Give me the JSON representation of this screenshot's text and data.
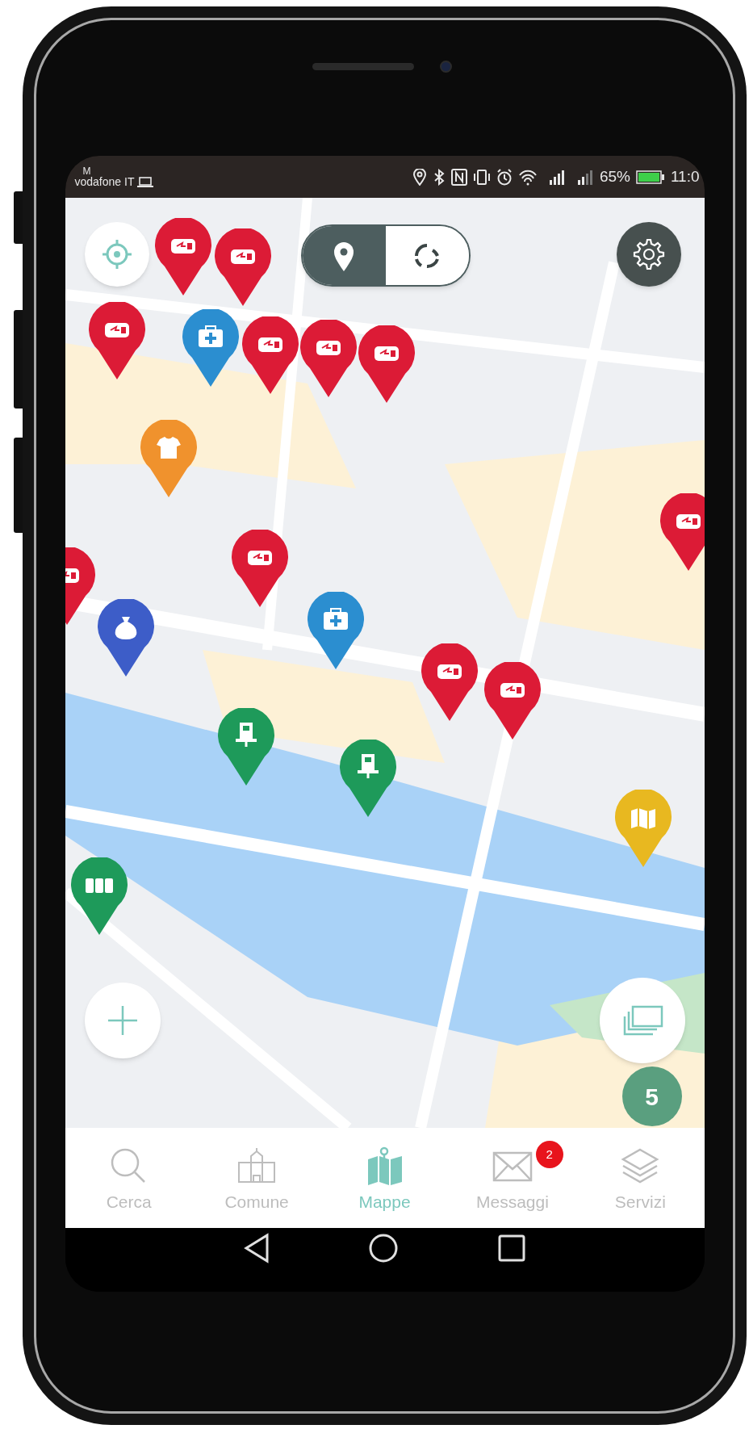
{
  "status_bar": {
    "carrier_line_1": "M",
    "carrier": "vodafone IT",
    "battery": "65%",
    "time": "11:0"
  },
  "mode_toggle": [
    {
      "kind": "pins",
      "selected": true
    },
    {
      "kind": "refresh",
      "selected": false
    }
  ],
  "markers": [
    {
      "kind": "charger",
      "color": "#dc1b36"
    },
    {
      "kind": "charger",
      "color": "#dc1b36"
    },
    {
      "kind": "charger",
      "color": "#dc1b36"
    },
    {
      "kind": "medical",
      "color": "#2b8ed0"
    },
    {
      "kind": "charger",
      "color": "#dc1b36"
    },
    {
      "kind": "charger",
      "color": "#dc1b36"
    },
    {
      "kind": "charger",
      "color": "#dc1b36"
    },
    {
      "kind": "shirt",
      "color": "#f0922d"
    },
    {
      "kind": "charger",
      "color": "#dc1b36"
    },
    {
      "kind": "charger",
      "color": "#dc1b36"
    },
    {
      "kind": "charger",
      "color": "#dc1b36"
    },
    {
      "kind": "medical",
      "color": "#2b8ed0"
    },
    {
      "kind": "sack",
      "color": "#3d5dc8"
    },
    {
      "kind": "charger",
      "color": "#dc1b36"
    },
    {
      "kind": "charger",
      "color": "#dc1b36"
    },
    {
      "kind": "device",
      "color": "#1e9a5a"
    },
    {
      "kind": "device",
      "color": "#1e9a5a"
    },
    {
      "kind": "map",
      "color": "#e8b820"
    },
    {
      "kind": "bins",
      "color": "#1e9a5a"
    }
  ],
  "cluster": {
    "count": "5"
  },
  "nav": [
    {
      "kind": "search",
      "label": "Cerca",
      "selected": false
    },
    {
      "kind": "town-hall",
      "label": "Comune",
      "selected": false
    },
    {
      "kind": "map",
      "label": "Mappe",
      "selected": true
    },
    {
      "kind": "mail",
      "label": "Messaggi",
      "selected": false,
      "badge": "2"
    },
    {
      "kind": "layers",
      "label": "Servizi",
      "selected": false
    }
  ]
}
